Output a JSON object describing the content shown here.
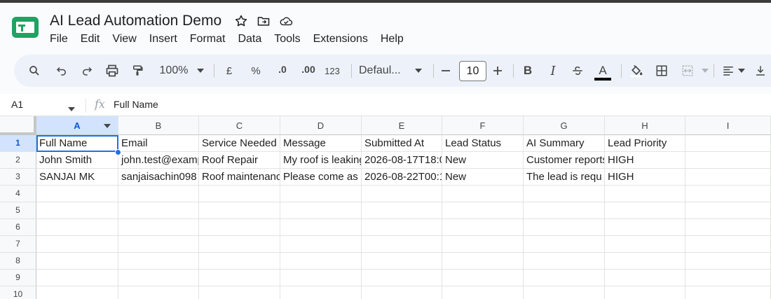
{
  "doc": {
    "title": "AI Lead Automation Demo"
  },
  "menu": [
    "File",
    "Edit",
    "View",
    "Insert",
    "Format",
    "Data",
    "Tools",
    "Extensions",
    "Help"
  ],
  "toolbar": {
    "zoom": "100%",
    "currency": "£",
    "percent": "%",
    "decrease_decimal": ".0",
    "increase_decimal": ".00",
    "number_format": "123",
    "font": "Defaul...",
    "font_size": "10",
    "bold": "B",
    "italic": "I",
    "text_color": "A"
  },
  "formula_bar": {
    "cell_ref": "A1",
    "fx": "fx",
    "content": "Full Name"
  },
  "columns": [
    "A",
    "B",
    "C",
    "D",
    "E",
    "F",
    "G",
    "H",
    "I"
  ],
  "row_numbers": [
    "1",
    "2",
    "3",
    "4",
    "5",
    "6",
    "7",
    "8",
    "9",
    "10"
  ],
  "rows": [
    [
      "Full Name",
      "Email",
      "Service Needed",
      "Message",
      "Submitted At",
      "Lead Status",
      "AI Summary",
      "Lead Priority",
      ""
    ],
    [
      "John Smith",
      "john.test@example.com",
      "Roof Repair",
      "My roof is leaking",
      "2026-08-17T18:0",
      "New",
      "Customer reports",
      "HIGH",
      ""
    ],
    [
      "SANJAI MK",
      "sanjaisachin098",
      "Roof maintenance",
      "Please come as",
      "2026-08-22T00:1",
      "New",
      "The lead is requ",
      "HIGH",
      ""
    ]
  ],
  "colors": {
    "accent": "#1a73e8",
    "selected_header": "#d3e3fd",
    "toolbar_bg": "#edf2fa"
  }
}
